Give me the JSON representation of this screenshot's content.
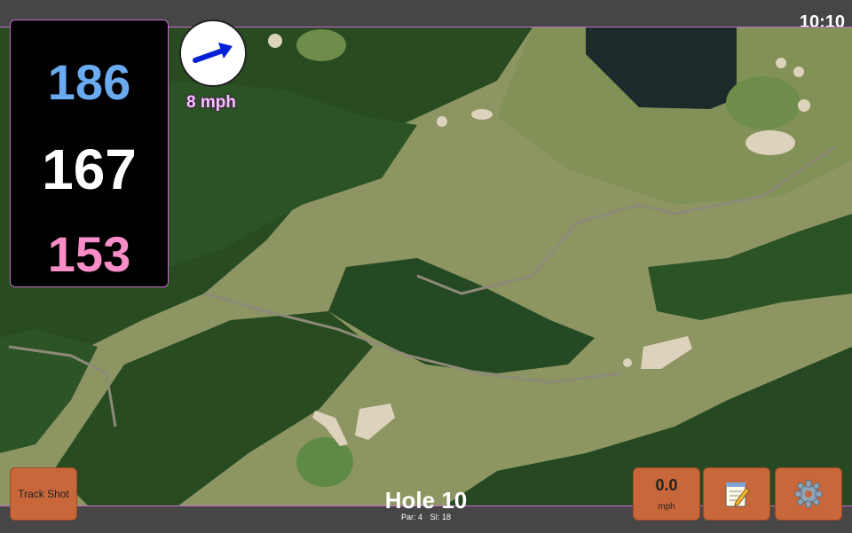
{
  "status": {
    "time": "10:10"
  },
  "distances": {
    "back": "186",
    "middle": "167",
    "front": "153"
  },
  "wind": {
    "speed": "8 mph",
    "icon": "wind-arrow-icon"
  },
  "buttons": {
    "track_shot": "Track Shot",
    "speed_value": "0.0",
    "speed_unit": "mph",
    "notes_icon": "notepad-icon",
    "settings_icon": "gear-icon"
  },
  "hole": {
    "title": "Hole 10",
    "par": "Par: 4",
    "si": "SI: 18"
  },
  "colors": {
    "back": "#6aaaf1",
    "middle": "#ffffff",
    "front": "#f88dc8",
    "button": "#c8673a",
    "accent": "#c86acf"
  }
}
